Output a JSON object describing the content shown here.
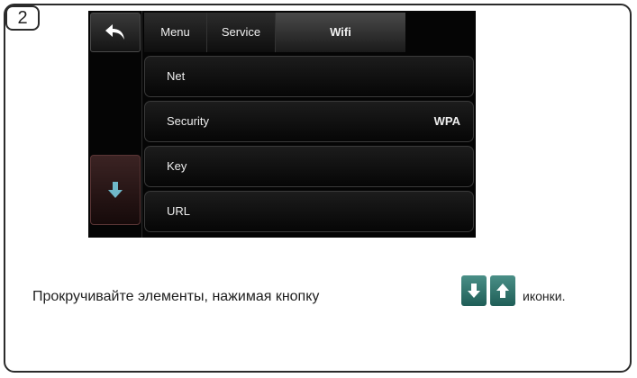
{
  "step": {
    "number": "2"
  },
  "screen": {
    "tabs": [
      {
        "label": "Menu"
      },
      {
        "label": "Service"
      },
      {
        "label": "Wifi"
      }
    ],
    "rows": [
      {
        "label": "Net",
        "value": ""
      },
      {
        "label": "Security",
        "value": "WPA"
      },
      {
        "label": "Key",
        "value": ""
      },
      {
        "label": "URL",
        "value": ""
      }
    ],
    "icons": {
      "back": "back-arrow-icon",
      "scroll_down": "arrow-down-icon"
    }
  },
  "instruction": {
    "text": "Прокручивайте элементы, нажимая кнопку",
    "suffix": "иконки.",
    "icons": [
      "arrow-down-icon",
      "arrow-up-icon"
    ]
  },
  "colors": {
    "screen_bg": "#050505",
    "scroll_icon_teal": "#2f7a72",
    "frame_border": "#2b2b2b"
  }
}
